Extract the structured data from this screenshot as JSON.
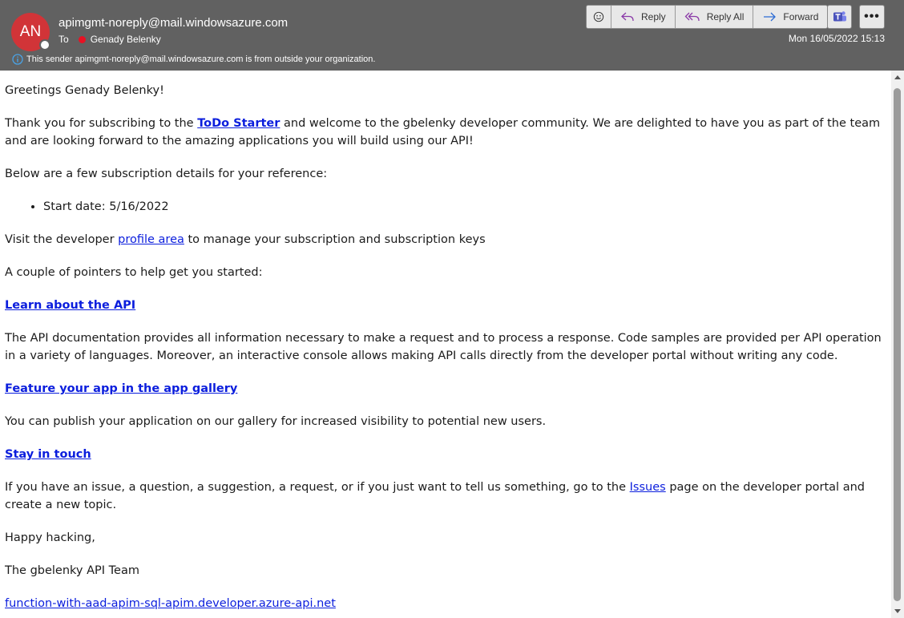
{
  "header": {
    "avatar_initials": "AN",
    "sender": "apimgmt-noreply@mail.windowsazure.com",
    "to_label": "To",
    "recipient": "Genady Belenky",
    "external_notice": "This sender apimgmt-noreply@mail.windowsazure.com is from outside your organization.",
    "date": "Mon 16/05/2022 15:13",
    "avatar_color": "#d13438"
  },
  "toolbar": {
    "reply_label": "Reply",
    "reply_all_label": "Reply All",
    "forward_label": "Forward",
    "more_label": "•••"
  },
  "body": {
    "greeting": "Greetings Genady Belenky!",
    "intro_before": "Thank you for subscribing to the ",
    "intro_link": "ToDo Starter",
    "intro_after": " and welcome to the gbelenky developer community. We are delighted to have you as part of the team and are looking forward to the amazing applications you will build using our API!",
    "details_heading": "Below are a few subscription details for your reference:",
    "start_date": "Start date: 5/16/2022",
    "visit_before": "Visit the developer ",
    "visit_link": "profile area",
    "visit_after": " to manage your subscription and subscription keys",
    "pointers": "A couple of pointers to help get you started:",
    "learn_link": "Learn about the API",
    "learn_text": "The API documentation provides all information necessary to make a request and to process a response. Code samples are provided per API operation in a variety of languages. Moreover, an interactive console allows making API calls directly from the developer portal without writing any code.",
    "feature_link": "Feature your app in the app gallery",
    "feature_text": "You can publish your application on our gallery for increased visibility to potential new users.",
    "touch_link": "Stay in touch",
    "touch_before": "If you have an issue, a question, a suggestion, a request, or if you just want to tell us something, go to the ",
    "touch_issues_link": "Issues",
    "touch_after": " page on the developer portal and create a new topic.",
    "happy": "Happy hacking,",
    "signature": "The gbelenky API Team",
    "portal_link": "function-with-aad-apim-sql-apim.developer.azure-api.net"
  }
}
